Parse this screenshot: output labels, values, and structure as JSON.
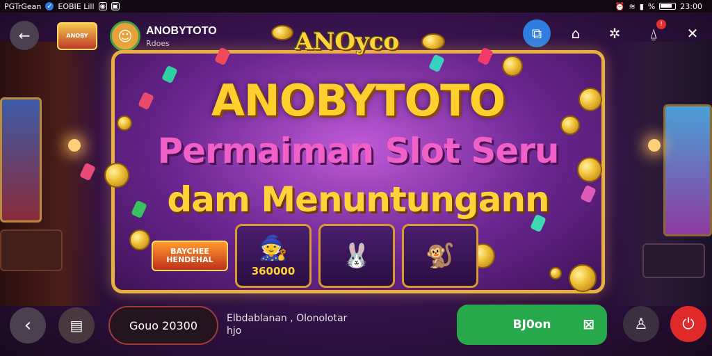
{
  "status_bar": {
    "left_text": "PGTrGean",
    "left_text_2": "EOBIE Lill",
    "time": "23:00",
    "battery_percent_label": "%"
  },
  "header": {
    "logo_text": "ANOBY",
    "app_title": "ANOBYTOTO",
    "app_subtitle": "Rdoes",
    "icons": [
      "back-icon",
      "cast-icon",
      "compass-icon",
      "settings-icon",
      "notification-icon",
      "close-icon"
    ],
    "notification_badge": "!"
  },
  "banner": {
    "tag": "ANOyco",
    "headline_1": "ANOBYTOTO",
    "headline_2": "Permaiman Slot Seru",
    "headline_3": "dam Menuntungann",
    "promo_label": "BAYCHEE HENDEHAL",
    "tiles": [
      {
        "icon": "hero-icon",
        "amount": "360000"
      },
      {
        "icon": "rabbit-icon",
        "amount": ""
      },
      {
        "icon": "monkey-icon",
        "amount": ""
      }
    ]
  },
  "bottom_bar": {
    "input_value": "Gouo 20300",
    "info_line_1": "Elbdablanan , Olonolotar",
    "info_line_2": "hjo",
    "cta_label": "BJ0on"
  },
  "colors": {
    "cta_green": "#27a84a",
    "power_red": "#e02a2a",
    "frame_gold": "#e8b040",
    "cast_blue": "#2e7de0"
  }
}
